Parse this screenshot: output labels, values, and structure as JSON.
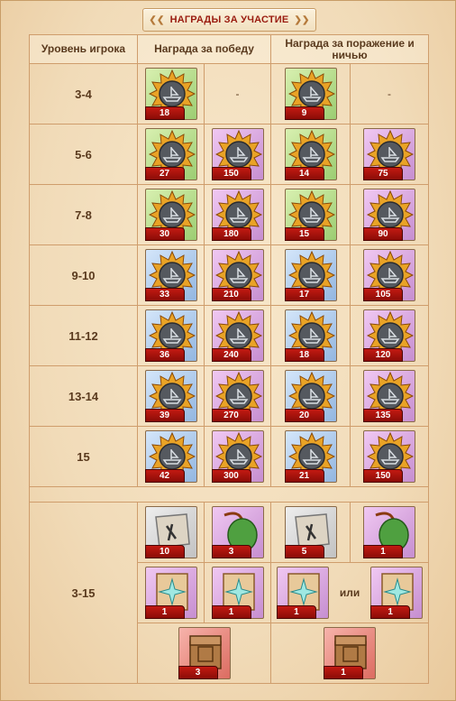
{
  "title": "НАГРАДЫ ЗА УЧАСТИЕ",
  "headers": {
    "level": "Уровень игрока",
    "win": "Награда за победу",
    "lose": "Награда за поражение и ничью"
  },
  "placeholder": "-",
  "or_label": "или",
  "rows": [
    {
      "level": "3-4",
      "win_medal": "18",
      "win_ship": "-",
      "lose_medal": "9",
      "lose_ship": "-"
    },
    {
      "level": "5-6",
      "win_medal": "27",
      "win_ship": "150",
      "lose_medal": "14",
      "lose_ship": "75"
    },
    {
      "level": "7-8",
      "win_medal": "30",
      "win_ship": "180",
      "lose_medal": "15",
      "lose_ship": "90"
    },
    {
      "level": "9-10",
      "win_medal": "33",
      "win_ship": "210",
      "lose_medal": "17",
      "lose_ship": "105"
    },
    {
      "level": "11-12",
      "win_medal": "36",
      "win_ship": "240",
      "lose_medal": "18",
      "lose_ship": "120"
    },
    {
      "level": "13-14",
      "win_medal": "39",
      "win_ship": "270",
      "lose_medal": "20",
      "lose_ship": "135"
    },
    {
      "level": "15",
      "win_medal": "42",
      "win_ship": "300",
      "lose_medal": "21",
      "lose_ship": "150"
    }
  ],
  "misc": {
    "level": "3-15",
    "win_scroll": "10",
    "win_bag": "3",
    "lose_scroll": "5",
    "lose_bag": "1",
    "win_map1": "1",
    "win_map2": "1",
    "lose_map1": "1",
    "lose_map2": "1",
    "win_chest": "3",
    "lose_chest": "1"
  },
  "icons": {
    "medal": "ship-medal-icon",
    "scroll": "torn-scroll-icon",
    "bag": "green-pouch-icon",
    "map": "compass-map-icon",
    "chest": "wooden-chest-icon"
  }
}
